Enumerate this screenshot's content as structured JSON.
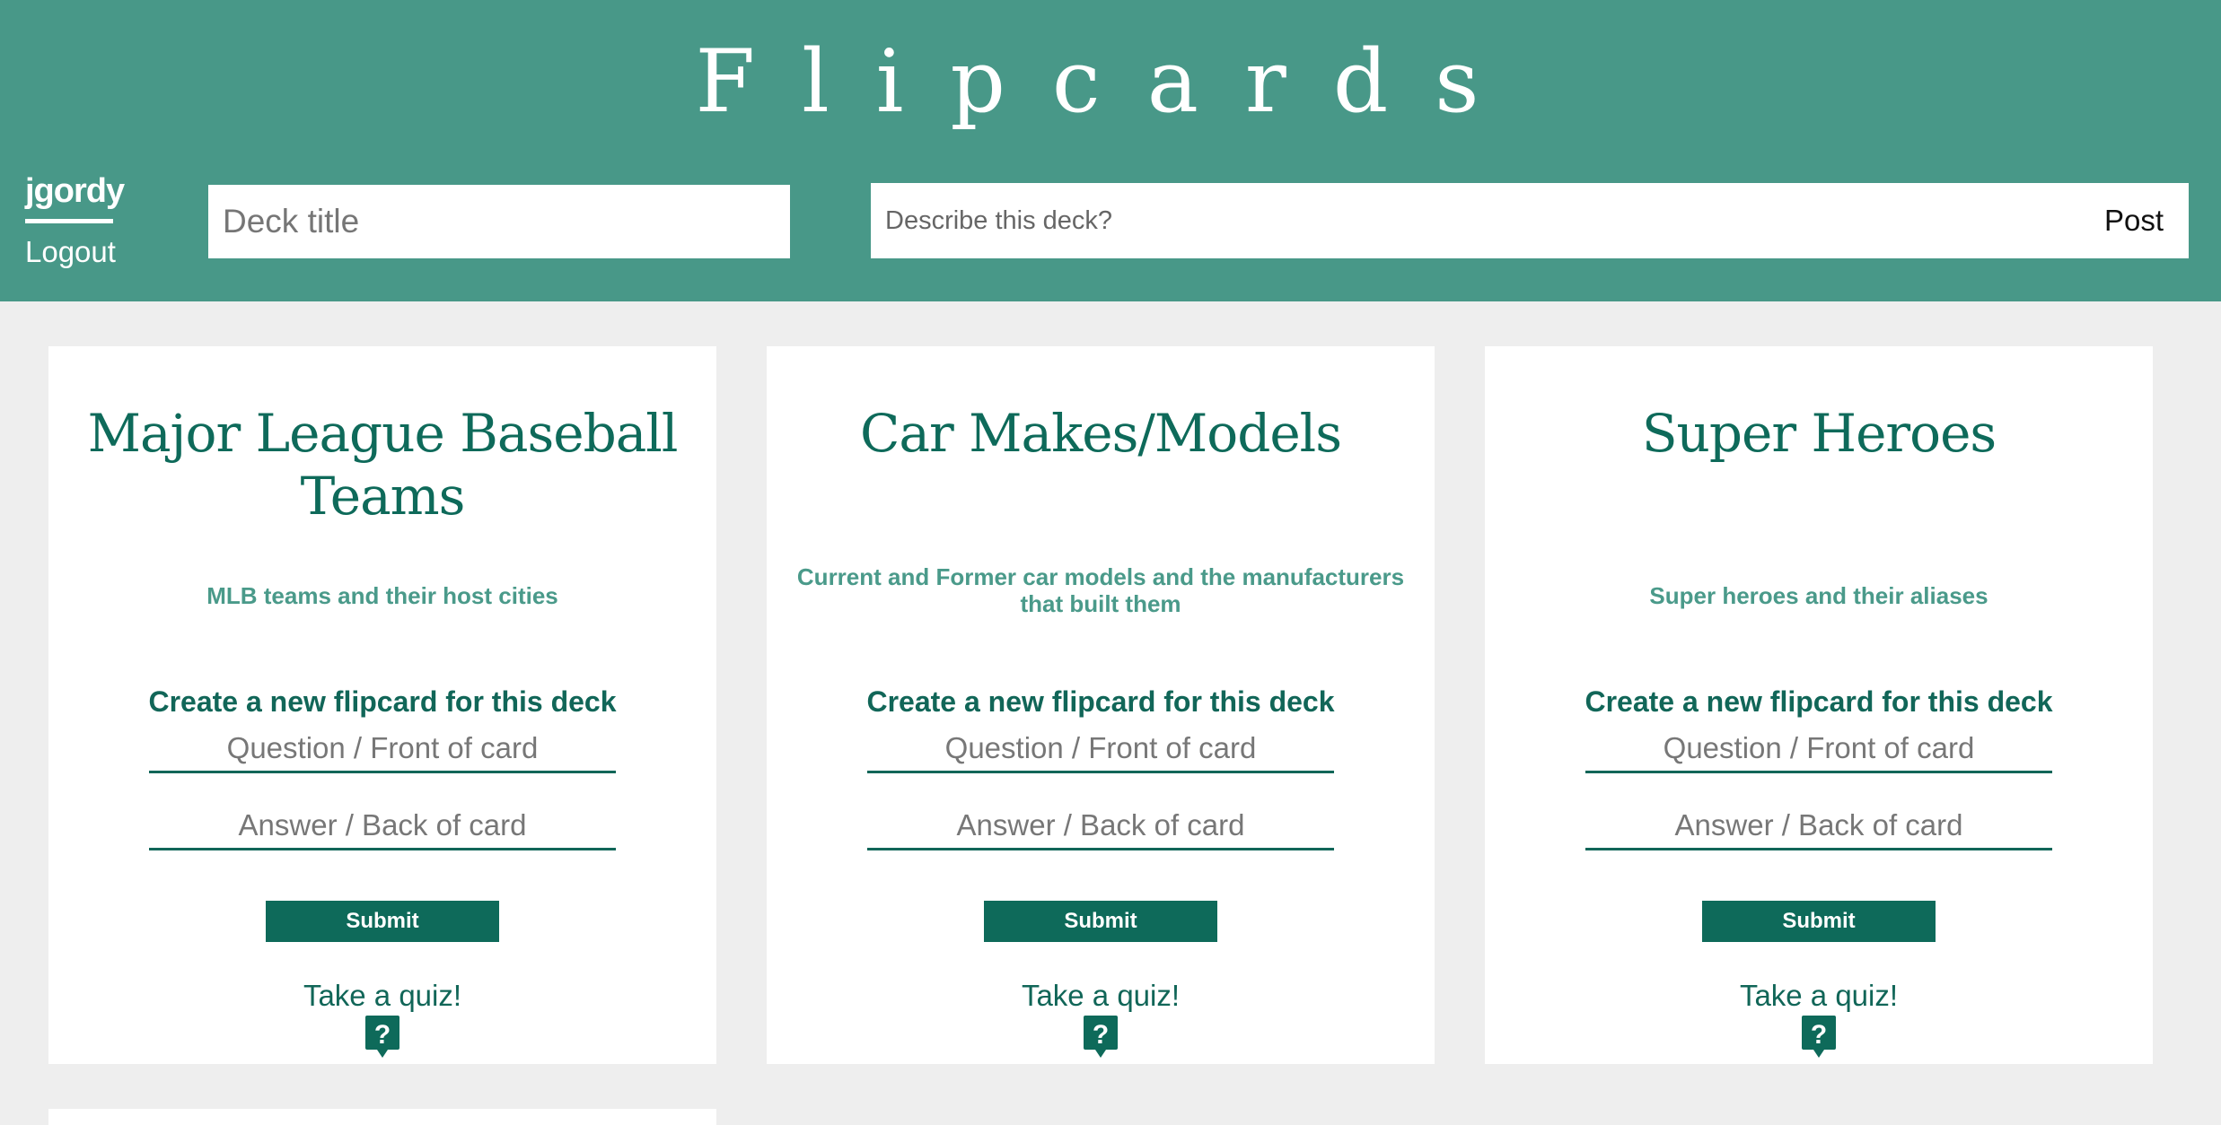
{
  "app": {
    "title": "Flipcards"
  },
  "user": {
    "username": "jgordy",
    "logout_label": "Logout"
  },
  "new_deck": {
    "title_placeholder": "Deck title",
    "description_placeholder": "Describe this deck?",
    "post_label": "Post"
  },
  "decks": [
    {
      "title": "Major League Baseball Teams",
      "description": "MLB teams and their host cities",
      "create_heading": "Create a new flipcard for this deck",
      "question_placeholder": "Question / Front of card",
      "answer_placeholder": "Answer / Back of card",
      "submit_label": "Submit",
      "quiz_label": "Take a quiz!",
      "quiz_icon": "question-mark-icon"
    },
    {
      "title": "Car Makes/Models",
      "description": "Current and Former car models and the manufacturers that built them",
      "create_heading": "Create a new flipcard for this deck",
      "question_placeholder": "Question / Front of card",
      "answer_placeholder": "Answer / Back of card",
      "submit_label": "Submit",
      "quiz_label": "Take a quiz!",
      "quiz_icon": "question-mark-icon"
    },
    {
      "title": "Super Heroes",
      "description": "Super heroes and their aliases",
      "create_heading": "Create a new flipcard for this deck",
      "question_placeholder": "Question / Front of card",
      "answer_placeholder": "Answer / Back of card",
      "submit_label": "Submit",
      "quiz_label": "Take a quiz!",
      "quiz_icon": "question-mark-icon"
    }
  ],
  "colors": {
    "header_bg": "#489888",
    "page_bg": "#eeeeee",
    "accent_dark": "#0e6a5a",
    "accent_light": "#4a9a8a"
  }
}
